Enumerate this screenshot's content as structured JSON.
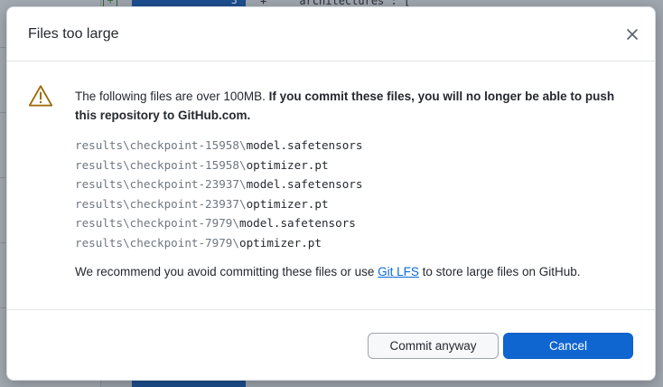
{
  "background": {
    "plus_glyph": "+",
    "line_number": "3",
    "code_snippet": "+    \"architectures\": ["
  },
  "dialog": {
    "title": "Files too large",
    "close_icon": "close-icon",
    "warning_icon": "warning-triangle-icon",
    "message_plain": "The following files are over 100MB. ",
    "message_bold": "If you commit these files, you will no longer be able to push this repository to GitHub.com.",
    "files": [
      {
        "dir": "results\\checkpoint-15958\\",
        "name": "model.safetensors"
      },
      {
        "dir": "results\\checkpoint-15958\\",
        "name": "optimizer.pt"
      },
      {
        "dir": "results\\checkpoint-23937\\",
        "name": "model.safetensors"
      },
      {
        "dir": "results\\checkpoint-23937\\",
        "name": "optimizer.pt"
      },
      {
        "dir": "results\\checkpoint-7979\\",
        "name": "model.safetensors"
      },
      {
        "dir": "results\\checkpoint-7979\\",
        "name": "optimizer.pt"
      }
    ],
    "recommend_before": "We recommend you avoid committing these files or use ",
    "recommend_link": "Git LFS",
    "recommend_after": " to store large files on GitHub.",
    "commit_anyway_label": "Commit anyway",
    "cancel_label": "Cancel"
  },
  "colors": {
    "primary": "#0f66d0",
    "warning": "#9a6700",
    "link": "#0969da"
  }
}
